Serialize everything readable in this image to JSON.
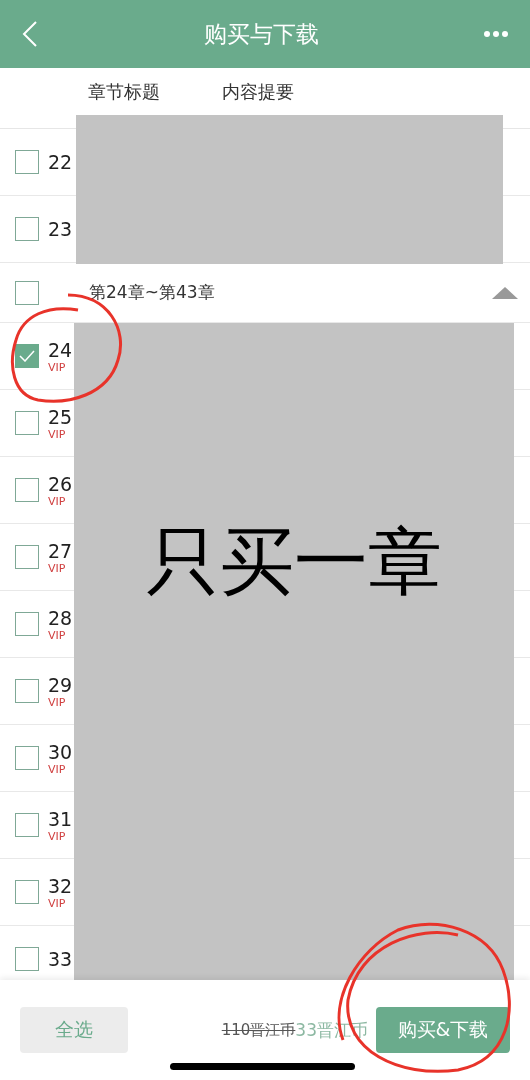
{
  "header": {
    "title": "购买与下载"
  },
  "tabs": [
    {
      "label": "章节标题",
      "selected": false
    },
    {
      "label": "内容提要",
      "selected": false
    }
  ],
  "chapters": [
    {
      "kind": "chapter",
      "number": "22",
      "checked": false
    },
    {
      "kind": "chapter",
      "number": "23",
      "checked": false
    },
    {
      "kind": "group",
      "title": "第24章~第43章",
      "checked": false,
      "expanded": true
    },
    {
      "kind": "chapter",
      "number": "24",
      "tag": "VIP",
      "checked": true
    },
    {
      "kind": "chapter",
      "number": "25",
      "tag": "VIP",
      "checked": false
    },
    {
      "kind": "chapter",
      "number": "26",
      "tag": "VIP",
      "checked": false
    },
    {
      "kind": "chapter",
      "number": "27",
      "tag": "VIP",
      "checked": false
    },
    {
      "kind": "chapter",
      "number": "28",
      "tag": "VIP",
      "checked": false
    },
    {
      "kind": "chapter",
      "number": "29",
      "tag": "VIP",
      "checked": false
    },
    {
      "kind": "chapter",
      "number": "30",
      "tag": "VIP",
      "checked": false
    },
    {
      "kind": "chapter",
      "number": "31",
      "tag": "VIP",
      "checked": false
    },
    {
      "kind": "chapter",
      "number": "32",
      "tag": "VIP",
      "checked": false
    },
    {
      "kind": "chapter",
      "number": "33",
      "checked": false
    }
  ],
  "overlay_note": "只买一章",
  "footer": {
    "select_all": "全选",
    "original_price": "110晋江币",
    "price": "33晋江币",
    "buy_button": "购买&下载"
  }
}
